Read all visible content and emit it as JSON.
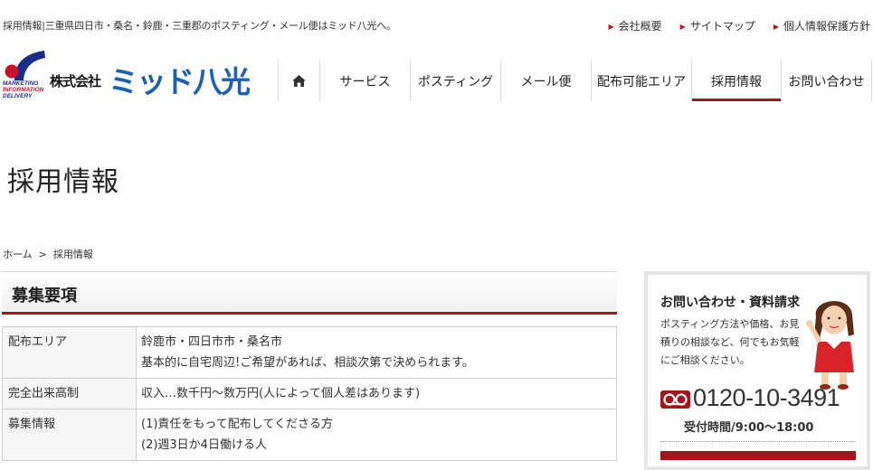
{
  "header": {
    "tagline": "採用情報|三重県四日市・桑名・鈴鹿・三重郡のポスティング・メール便はミッド八光へ。",
    "links": [
      "会社概要",
      "サイトマップ",
      "個人情報保護方針"
    ]
  },
  "logo": {
    "company": "株式会社",
    "brand": "ミッド八光",
    "mark_lines": [
      "MARKETING",
      "INFORMATION",
      "DELIVERY"
    ]
  },
  "nav": {
    "items": [
      {
        "label": "",
        "icon": "home-icon"
      },
      {
        "label": "サービス"
      },
      {
        "label": "ポスティング"
      },
      {
        "label": "メール便"
      },
      {
        "label": "配布可能エリア"
      },
      {
        "label": "採用情報",
        "active": true
      },
      {
        "label": "お問い合わせ"
      }
    ]
  },
  "page": {
    "title": "採用情報"
  },
  "breadcrumb": {
    "home": "ホーム",
    "separator": ">",
    "current": "採用情報"
  },
  "main": {
    "section_title": "募集要項",
    "rows": [
      {
        "label": "配布エリア",
        "lines": [
          "鈴鹿市・四日市市・桑名市",
          "基本的に自宅周辺!ご希望があれば、相談次第で決められます。"
        ]
      },
      {
        "label": "完全出来高制",
        "lines": [
          "収入…数千円〜数万円(人によって個人差はあります)"
        ]
      },
      {
        "label": "募集情報",
        "lines": [
          "(1)責任をもって配布してくださる方",
          "(2)週3日か4日働ける人"
        ]
      }
    ]
  },
  "sidebar": {
    "title": "お問い合わせ・資料請求",
    "description": "ポスティング方法や価格、お見積りの相談など、何でもお気軽にご相談ください。",
    "phone": "0120-10-3491",
    "hours": "受付時間/9:00〜18:00"
  },
  "colors": {
    "accent": "#a5141c",
    "brand_blue": "#1d5fb0",
    "navy": "#1b2e86"
  }
}
